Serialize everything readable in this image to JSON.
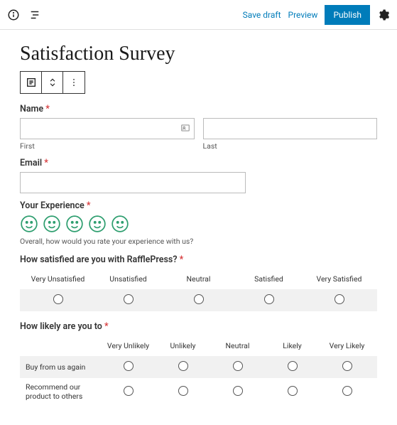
{
  "topbar": {
    "save_draft": "Save draft",
    "preview": "Preview",
    "publish": "Publish"
  },
  "page_title": "Satisfaction Survey",
  "fields": {
    "name": {
      "label": "Name",
      "first_sublabel": "First",
      "last_sublabel": "Last"
    },
    "email": {
      "label": "Email"
    },
    "experience": {
      "label": "Your Experience",
      "help": "Overall, how would you rate your experience with us?"
    },
    "satisfaction": {
      "label": "How satisfied are you with RafflePress?",
      "scale": [
        "Very Unsatisfied",
        "Unsatisfied",
        "Neutral",
        "Satisfied",
        "Very Satisfied"
      ]
    },
    "likelihood": {
      "label": "How likely are you to",
      "scale": [
        "Very Unlikely",
        "Unlikely",
        "Neutral",
        "Likely",
        "Very Likely"
      ],
      "rows": [
        "Buy from us again",
        "Recommend our product to others"
      ]
    }
  },
  "asterisk": "*"
}
